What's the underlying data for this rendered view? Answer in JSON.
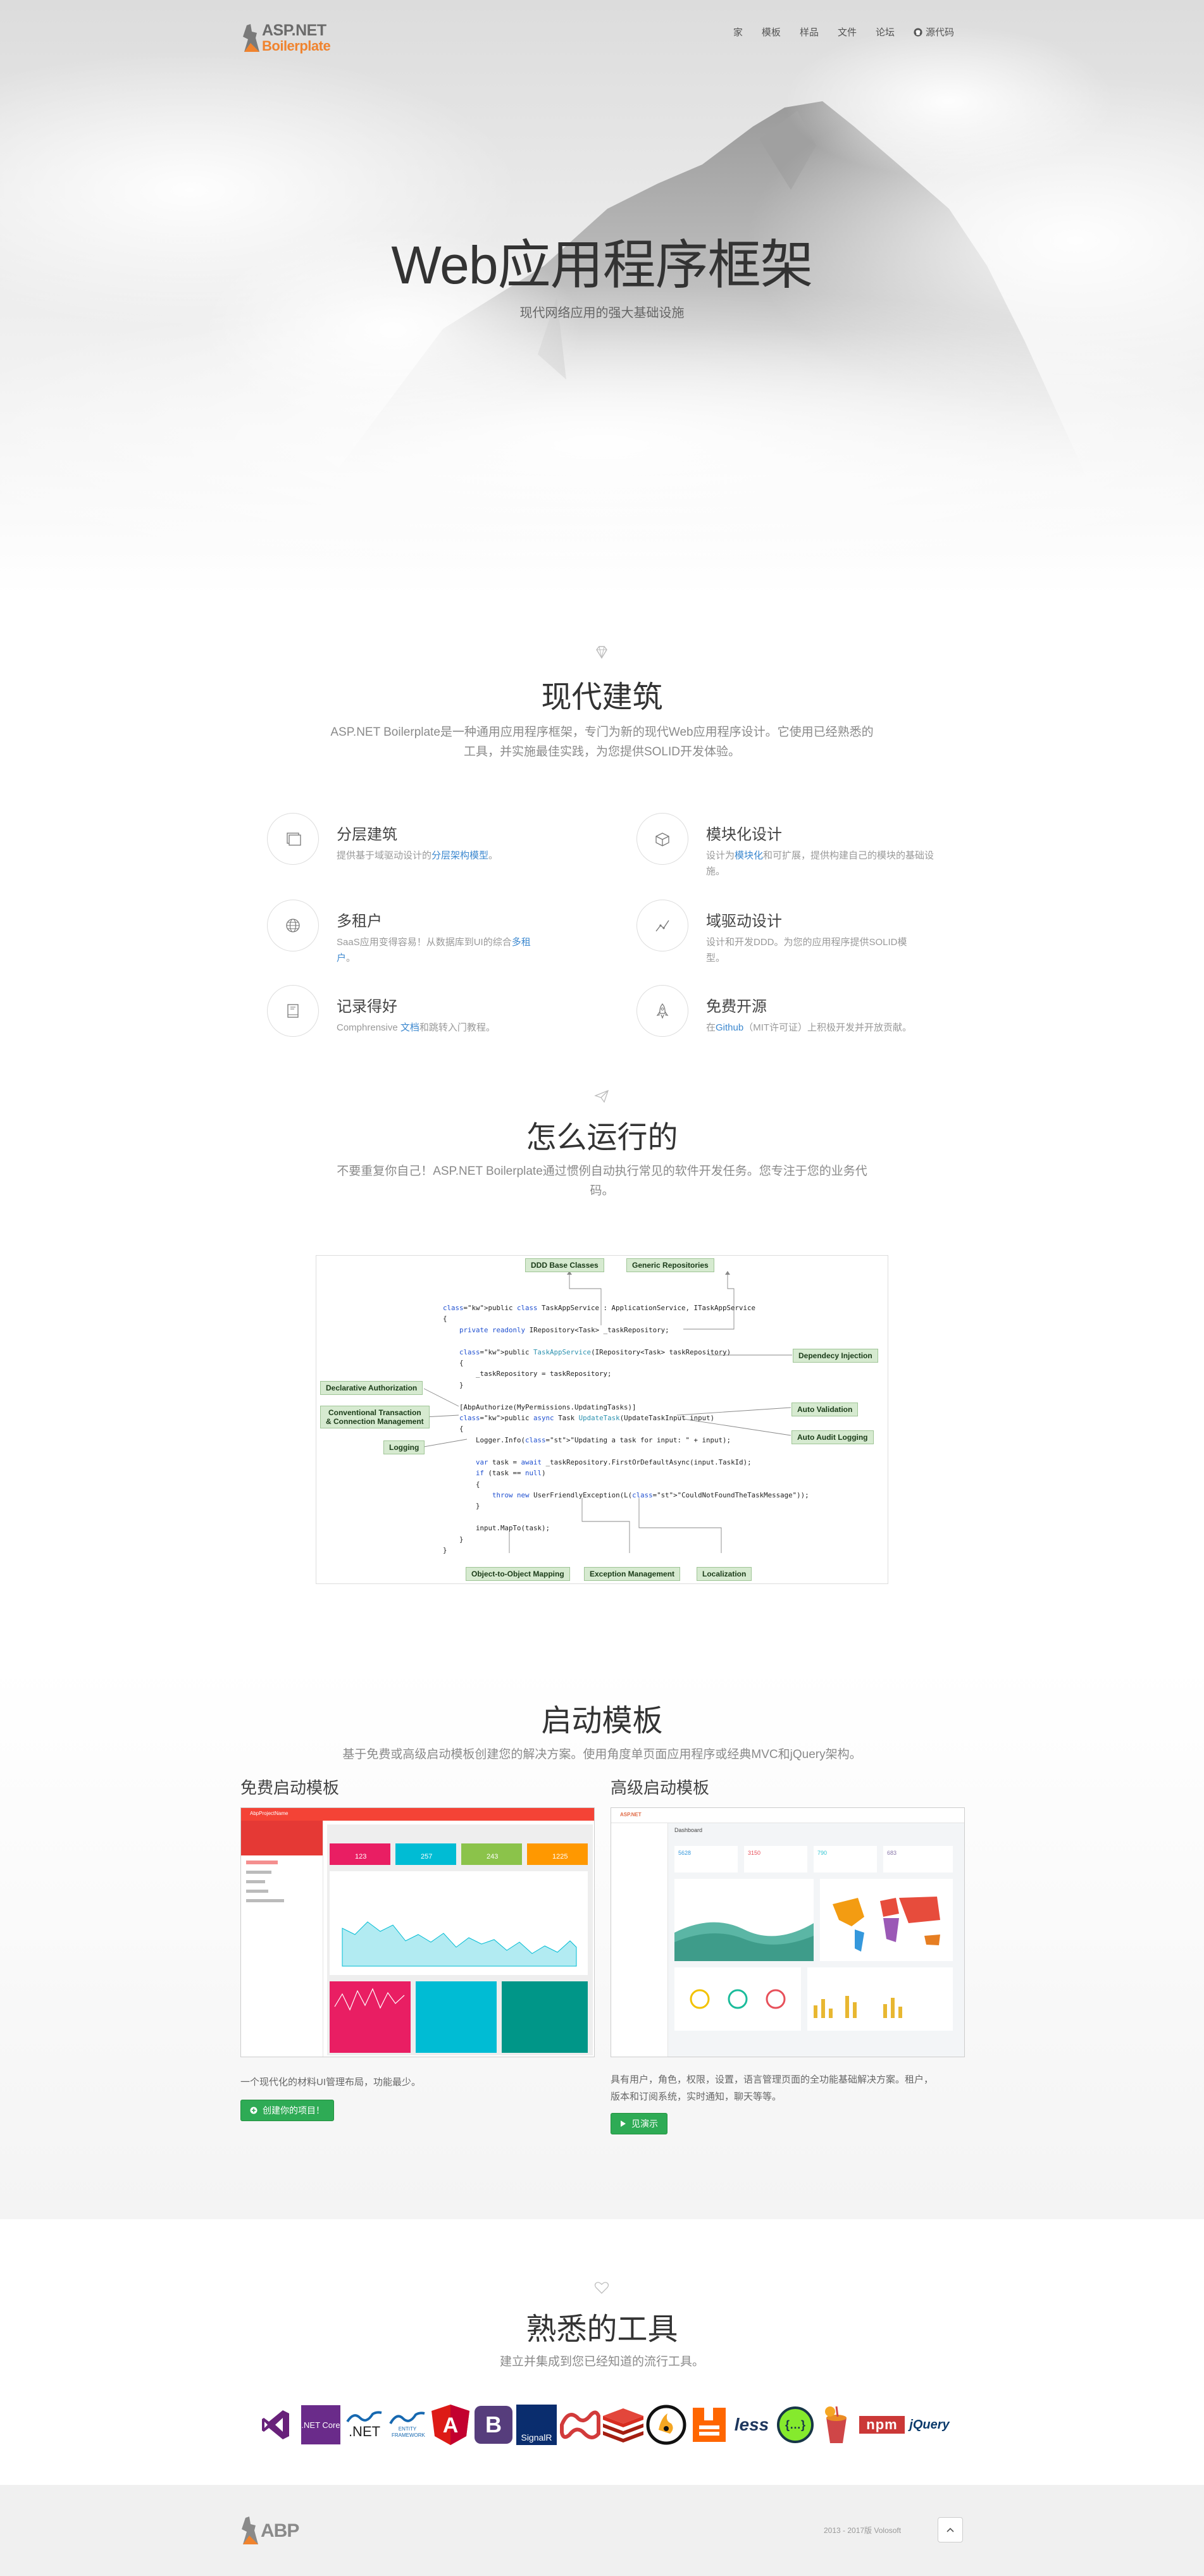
{
  "nav": {
    "logo_line1": "ASP.NET",
    "logo_line2": "Boilerplate",
    "items": [
      "家",
      "模板",
      "样品",
      "文件",
      "论坛"
    ],
    "source_label": "源代码"
  },
  "hero": {
    "title": "Web应用程序框架",
    "subtitle": "现代网络应用的强大基础设施"
  },
  "architecture": {
    "title": "现代建筑",
    "desc_line1": "ASP.NET Boilerplate是一种通用应用程序框架，专门为新的现代Web应用程序设计。它使用已经熟悉的",
    "desc_line2": "工具，并实施最佳实践，为您提供SOLID开发体验。",
    "features": [
      {
        "icon": "layers-icon",
        "title": "分层建筑",
        "text_before": "提供基于域驱动设计的",
        "link": "分层架构模型",
        "text_after": "。"
      },
      {
        "icon": "module-box-icon",
        "title": "模块化设计",
        "text_before": "设计为",
        "link": "模块化",
        "text_after": "和可扩展，提供构建自己的模块的基础设施。"
      },
      {
        "icon": "globe-icon",
        "title": "多租户",
        "text_before": "SaaS应用变得容易！从数据库到UI的综合",
        "link": "多租户",
        "text_after": "。"
      },
      {
        "icon": "chart-line-icon",
        "title": "域驱动设计",
        "text_before": "设计和开发DDD。为您的应用程序提供SOLID模型。",
        "link": "",
        "text_after": ""
      },
      {
        "icon": "book-icon",
        "title": "记录得好",
        "text_before": "Comphrensive ",
        "link": "文档",
        "text_after": "和跳转入门教程。"
      },
      {
        "icon": "rocket-icon",
        "title": "免费开源",
        "text_before": "在",
        "link": "Github",
        "text_after": "（MIT许可证）上积极开发并开放贡献。"
      }
    ]
  },
  "how": {
    "title": "怎么运行的",
    "desc_line1": "不要重复你自己！ASP.NET Boilerplate通过惯例自动执行常见的软件开发任务。您专注于您的业务代",
    "desc_line2": "码。",
    "tags": {
      "ddd": "DDD Base Classes",
      "repo": "Generic Repositories",
      "di": "Dependecy Injection",
      "auth": "Declarative Authorization",
      "uow_line1": "Conventional Transaction",
      "uow_line2": "& Connection Management",
      "logging": "Logging",
      "validation": "Auto Validation",
      "audit": "Auto Audit Logging",
      "mapping": "Object-to-Object Mapping",
      "exception": "Exception Management",
      "localization": "Localization"
    },
    "code": [
      "public class TaskAppService : ApplicationService, ITaskAppService",
      "{",
      "    private readonly IRepository<Task> _taskRepository;",
      "",
      "    public TaskAppService(IRepository<Task> taskRepository)",
      "    {",
      "        _taskRepository = taskRepository;",
      "    }",
      "",
      "    [AbpAuthorize(MyPermissions.UpdatingTasks)]",
      "    public async Task UpdateTask(UpdateTaskInput input)",
      "    {",
      "        Logger.Info(\"Updating a task for input: \" + input);",
      "",
      "        var task = await _taskRepository.FirstOrDefaultAsync(input.TaskId);",
      "        if (task == null)",
      "        {",
      "            throw new UserFriendlyException(L(\"CouldNotFoundTheTaskMessage\"));",
      "        }",
      "",
      "        input.MapTo(task);",
      "    }",
      "}"
    ]
  },
  "templates": {
    "title": "启动模板",
    "desc": "基于免费或高级启动模板创建您的解决方案。使用角度单页面应用程序或经典MVC和jQuery架构。",
    "free": {
      "heading": "免费启动模板",
      "text": "一个现代化的材料UI管理布局，功能最少。",
      "button": "创建你的项目！",
      "screenshot": {
        "brand": "AbpProjectName",
        "stats": [
          "123",
          "257",
          "243",
          "1225"
        ]
      }
    },
    "premium": {
      "heading": "高级启动模板",
      "text_line1": "具有用户，角色，权限，设置，语言管理页面的全功能基础解决方案。租户，",
      "text_line2": "版本和订阅系统，实时通知，聊天等等。",
      "button": "见演示",
      "screenshot": {
        "brand": "ASP.NET",
        "page_title": "Dashboard",
        "stats": [
          "5628",
          "3150",
          "790",
          "683"
        ]
      }
    }
  },
  "tools": {
    "title": "熟悉的工具",
    "desc": "建立并集成到您已经知道的流行工具。",
    "items": [
      {
        "name": "visual-studio",
        "label": ""
      },
      {
        "name": "dotnet-core",
        "label": ".NET Core"
      },
      {
        "name": "microsoft-net",
        "label": ".NET"
      },
      {
        "name": "entity-framework",
        "label": "ENTITY FRAMEWORK"
      },
      {
        "name": "angular",
        "label": "A"
      },
      {
        "name": "bootstrap",
        "label": "B"
      },
      {
        "name": "signalr",
        "label": "SignalR"
      },
      {
        "name": "castle-windsor",
        "label": ""
      },
      {
        "name": "redis",
        "label": ""
      },
      {
        "name": "hangfire",
        "label": ""
      },
      {
        "name": "rabbitmq",
        "label": ""
      },
      {
        "name": "less",
        "label": "less"
      },
      {
        "name": "swagger",
        "label": "{…}"
      },
      {
        "name": "gulp",
        "label": ""
      },
      {
        "name": "npm",
        "label": "npm"
      },
      {
        "name": "jquery",
        "label": "jQuery"
      }
    ]
  },
  "footer": {
    "logo": "ABP",
    "copyright": "2013 - 2017版 Volosoft"
  }
}
